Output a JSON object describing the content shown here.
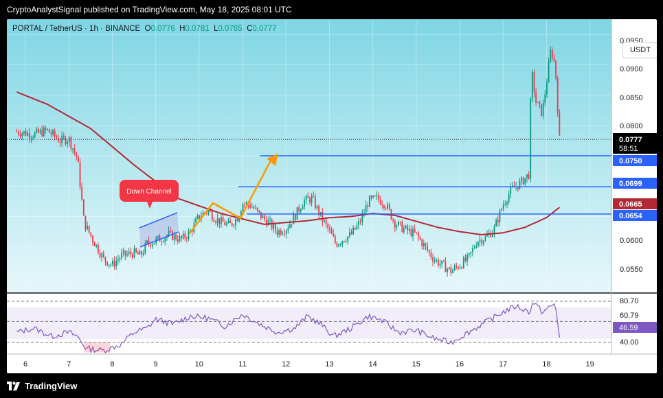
{
  "header": {
    "published_text": "CryptoAnalystSignal published on TradingView.com, May 18, 2025 08:01 UTC"
  },
  "symbol": {
    "pair": "PORTAL / TetherUS · 1h · BINANCE",
    "o_label": "O",
    "o": "0.0776",
    "h_label": "H",
    "h": "0.0781",
    "l_label": "L",
    "l": "0.0765",
    "c_label": "C",
    "c": "0.0777"
  },
  "currency_button": "USDT",
  "price_axis": {
    "ticks": [
      "0.0950",
      "0.0900",
      "0.0850",
      "0.0800",
      "0.0600",
      "0.0550"
    ]
  },
  "price_labels": {
    "current": "0.0777",
    "countdown": "58:51",
    "level_1": "0.0750",
    "level_2": "0.0699",
    "ma": "0.0665",
    "level_3": "0.0654"
  },
  "annotation": {
    "callout": "Down Channel"
  },
  "rsi_axis": {
    "upper": "80.70",
    "middle": "60.79",
    "lower": "40.00",
    "current": "46.59"
  },
  "time_axis": {
    "labels": [
      "6",
      "7",
      "8",
      "9",
      "10",
      "11",
      "12",
      "13",
      "14",
      "15",
      "16",
      "17",
      "18",
      "19"
    ]
  },
  "footer": {
    "brand": "TradingView"
  },
  "colors": {
    "up": "#089981",
    "down": "#f23645",
    "level_line": "#2962ff",
    "ma": "#b22833",
    "rsi": "#7e57c2",
    "arrow": "#ff9800",
    "bg_top": "#7fd6e4",
    "bg_bottom": "#e6f7fa"
  },
  "chart_data": {
    "type": "candlestick",
    "x_labels": [
      "6",
      "7",
      "8",
      "9",
      "10",
      "11",
      "12",
      "13",
      "14",
      "15",
      "16",
      "17",
      "18",
      "19"
    ],
    "ylim": [
      0.0525,
      0.0975
    ],
    "close_path": [
      [
        5.8,
        0.079
      ],
      [
        6.2,
        0.0785
      ],
      [
        6.5,
        0.0792
      ],
      [
        6.8,
        0.0775
      ],
      [
        7.0,
        0.0778
      ],
      [
        7.2,
        0.0745
      ],
      [
        7.35,
        0.064
      ],
      [
        7.55,
        0.0612
      ],
      [
        7.8,
        0.058
      ],
      [
        8.0,
        0.057
      ],
      [
        8.2,
        0.0585
      ],
      [
        8.5,
        0.059
      ],
      [
        8.65,
        0.0585
      ],
      [
        8.8,
        0.0605
      ],
      [
        9.0,
        0.061
      ],
      [
        9.3,
        0.062
      ],
      [
        9.6,
        0.0612
      ],
      [
        9.8,
        0.0625
      ],
      [
        10.0,
        0.065
      ],
      [
        10.2,
        0.066
      ],
      [
        10.4,
        0.0645
      ],
      [
        10.7,
        0.0635
      ],
      [
        10.9,
        0.065
      ],
      [
        11.0,
        0.0672
      ],
      [
        11.2,
        0.0668
      ],
      [
        11.4,
        0.0652
      ],
      [
        11.6,
        0.064
      ],
      [
        11.8,
        0.0625
      ],
      [
        12.0,
        0.063
      ],
      [
        12.2,
        0.065
      ],
      [
        12.4,
        0.0675
      ],
      [
        12.6,
        0.068
      ],
      [
        12.8,
        0.065
      ],
      [
        13.0,
        0.0625
      ],
      [
        13.15,
        0.0605
      ],
      [
        13.3,
        0.0612
      ],
      [
        13.5,
        0.062
      ],
      [
        13.7,
        0.064
      ],
      [
        13.9,
        0.0675
      ],
      [
        14.1,
        0.068
      ],
      [
        14.3,
        0.067
      ],
      [
        14.5,
        0.064
      ],
      [
        14.7,
        0.063
      ],
      [
        15.0,
        0.062
      ],
      [
        15.2,
        0.06
      ],
      [
        15.4,
        0.058
      ],
      [
        15.6,
        0.057
      ],
      [
        15.8,
        0.056
      ],
      [
        16.0,
        0.057
      ],
      [
        16.2,
        0.058
      ],
      [
        16.4,
        0.061
      ],
      [
        16.6,
        0.0615
      ],
      [
        16.8,
        0.063
      ],
      [
        17.0,
        0.067
      ],
      [
        17.2,
        0.0695
      ],
      [
        17.4,
        0.0705
      ],
      [
        17.6,
        0.072
      ],
      [
        17.65,
        0.0895
      ],
      [
        17.75,
        0.084
      ],
      [
        17.9,
        0.082
      ],
      [
        18.0,
        0.087
      ],
      [
        18.1,
        0.0925
      ],
      [
        18.2,
        0.09
      ],
      [
        18.3,
        0.0777
      ]
    ],
    "moving_average": [
      [
        5.8,
        0.0855
      ],
      [
        6.5,
        0.0835
      ],
      [
        7.5,
        0.0795
      ],
      [
        8.5,
        0.0735
      ],
      [
        9.5,
        0.068
      ],
      [
        10.5,
        0.0655
      ],
      [
        11.5,
        0.0637
      ],
      [
        12.5,
        0.0643
      ],
      [
        13.0,
        0.0648
      ],
      [
        13.5,
        0.065
      ],
      [
        14.0,
        0.0655
      ],
      [
        14.5,
        0.0652
      ],
      [
        15.0,
        0.0642
      ],
      [
        15.5,
        0.0632
      ],
      [
        16.0,
        0.0625
      ],
      [
        16.5,
        0.062
      ],
      [
        17.0,
        0.0623
      ],
      [
        17.5,
        0.0632
      ],
      [
        18.0,
        0.0648
      ],
      [
        18.3,
        0.0665
      ]
    ],
    "horizontal_levels": [
      {
        "label": "0.0750",
        "value": 0.075,
        "from_x": 11.4
      },
      {
        "label": "0.0699",
        "value": 0.0699,
        "from_x": 10.9
      },
      {
        "label": "0.0654",
        "value": 0.0654,
        "from_x": 11.1
      }
    ],
    "rsi": {
      "levels": [
        80.7,
        60.79,
        40.0
      ],
      "current": 46.59,
      "path": [
        [
          5.8,
          50
        ],
        [
          6.2,
          54
        ],
        [
          6.6,
          46
        ],
        [
          7.0,
          50
        ],
        [
          7.2,
          46
        ],
        [
          7.4,
          34
        ],
        [
          7.8,
          32
        ],
        [
          8.2,
          38
        ],
        [
          8.5,
          50
        ],
        [
          8.8,
          54
        ],
        [
          9.0,
          63
        ],
        [
          9.4,
          58
        ],
        [
          9.8,
          66
        ],
        [
          10.2,
          64
        ],
        [
          10.6,
          56
        ],
        [
          11.0,
          68
        ],
        [
          11.4,
          58
        ],
        [
          11.8,
          50
        ],
        [
          12.2,
          54
        ],
        [
          12.5,
          66
        ],
        [
          12.8,
          58
        ],
        [
          13.1,
          46
        ],
        [
          13.5,
          54
        ],
        [
          13.9,
          66
        ],
        [
          14.2,
          62
        ],
        [
          14.6,
          50
        ],
        [
          15.0,
          52
        ],
        [
          15.4,
          44
        ],
        [
          15.8,
          40
        ],
        [
          16.2,
          50
        ],
        [
          16.6,
          60
        ],
        [
          17.0,
          70
        ],
        [
          17.3,
          76
        ],
        [
          17.6,
          70
        ],
        [
          17.7,
          80
        ],
        [
          17.9,
          70
        ],
        [
          18.2,
          78
        ],
        [
          18.3,
          46.59
        ]
      ]
    }
  }
}
